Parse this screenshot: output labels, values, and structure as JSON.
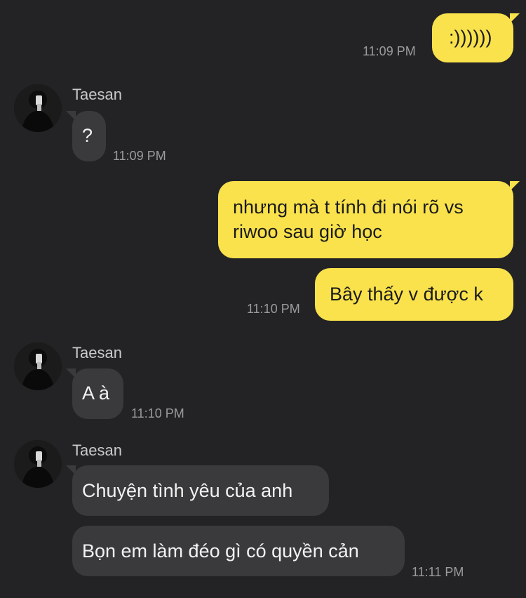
{
  "colors": {
    "background": "#232325",
    "my_bubble": "#fae24c",
    "their_bubble": "#3a3a3c",
    "timestamp": "#9b9b9f"
  },
  "messages": [
    {
      "sender": "me",
      "text": ":))))))",
      "time": "11:09 PM"
    },
    {
      "sender": "Taesan",
      "name": "Taesan",
      "avatar_icon": "profile-photo-avatar-icon",
      "text": "?",
      "time": "11:09 PM"
    },
    {
      "sender": "me",
      "text_line1": "nhưng mà t tính đi nói rõ vs",
      "text_line2": "riwoo sau giờ học"
    },
    {
      "sender": "me",
      "text": "Bây thấy v được k",
      "time": "11:10 PM"
    },
    {
      "sender": "Taesan",
      "name": "Taesan",
      "avatar_icon": "profile-photo-avatar-icon",
      "text": "A à",
      "time": "11:10 PM"
    },
    {
      "sender": "Taesan",
      "name": "Taesan",
      "avatar_icon": "profile-photo-avatar-icon",
      "text": "Chuyện tình yêu của anh"
    },
    {
      "sender": "Taesan",
      "text": "Bọn em làm đéo gì có quyền cản",
      "time": "11:11 PM"
    }
  ]
}
